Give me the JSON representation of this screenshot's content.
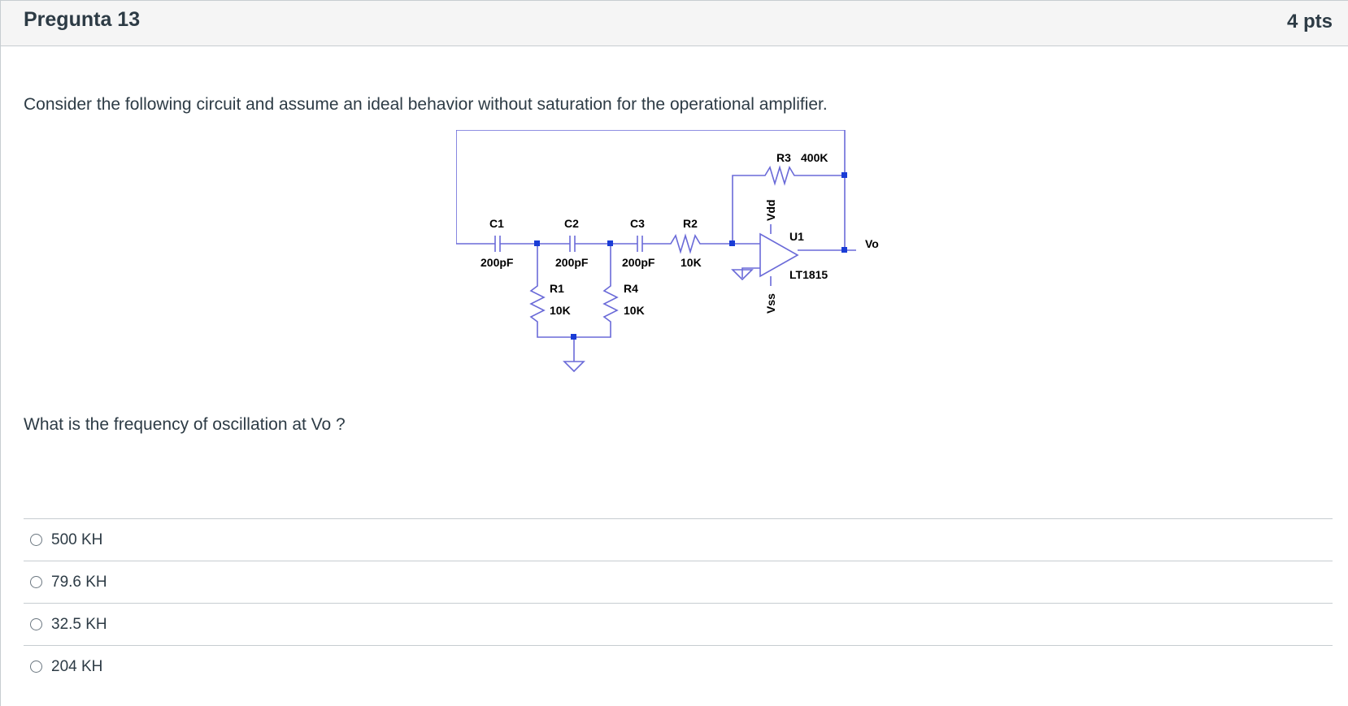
{
  "question": {
    "title": "Pregunta 13",
    "points": "4 pts",
    "text": "Consider the following circuit and assume an ideal behavior without saturation for the operational amplifier.",
    "subquestion": "What is the frequency of oscillation at Vo ?"
  },
  "circuit": {
    "c1_name": "C1",
    "c1_value": "200pF",
    "c2_name": "C2",
    "c2_value": "200pF",
    "c3_name": "C3",
    "c3_value": "200pF",
    "r1_name": "R1",
    "r1_value": "10K",
    "r2_name": "R2",
    "r2_value": "10K",
    "r3_name": "R3",
    "r3_value": "400K",
    "r4_name": "R4",
    "r4_value": "10K",
    "opamp_name": "U1",
    "opamp_model": "LT1815",
    "vdd_label": "Vdd",
    "vss_label": "Vss",
    "output_label": "Vo",
    "wire_color": "#6a6ad8",
    "node_color": "#1a3cd6"
  },
  "answers": [
    {
      "label": "500 KH"
    },
    {
      "label": "79.6 KH"
    },
    {
      "label": "32.5 KH"
    },
    {
      "label": "204 KH"
    }
  ]
}
